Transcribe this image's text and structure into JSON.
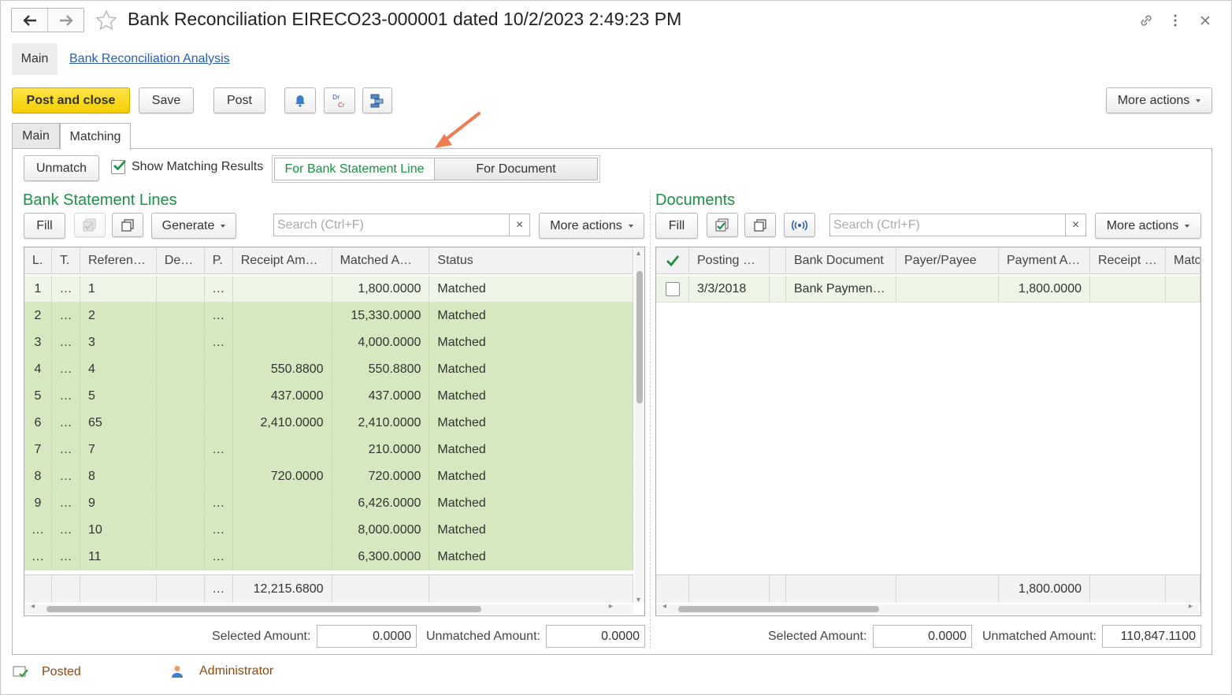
{
  "header": {
    "title": "Bank Reconciliation EIRECO23-000001 dated 10/2/2023 2:49:23 PM"
  },
  "top_links": {
    "main": "Main",
    "analysis": "Bank Reconciliation Analysis"
  },
  "toolbar": {
    "post_and_close": "Post and close",
    "save": "Save",
    "post": "Post",
    "more_actions": "More actions"
  },
  "tabs": [
    "Main",
    "Matching"
  ],
  "matching": {
    "unmatch": "Unmatch",
    "show_results": "Show Matching Results",
    "toggle": {
      "left": "For Bank Statement Line",
      "right": "For Document"
    }
  },
  "bank_lines": {
    "title": "Bank Statement Lines",
    "fill": "Fill",
    "generate": "Generate",
    "search_placeholder": "Search (Ctrl+F)",
    "more_actions": "More actions",
    "columns": [
      "L.",
      "T.",
      "Referen…",
      "De…",
      "P.",
      "Receipt Am…",
      "Matched A…",
      "Status"
    ],
    "rows": [
      [
        "1",
        "…",
        "1",
        "",
        "…",
        "",
        "1,800.0000",
        "Matched"
      ],
      [
        "2",
        "…",
        "2",
        "",
        "…",
        "",
        "15,330.0000",
        "Matched"
      ],
      [
        "3",
        "…",
        "3",
        "",
        "…",
        "",
        "4,000.0000",
        "Matched"
      ],
      [
        "4",
        "…",
        "4",
        "",
        "",
        "550.8800",
        "550.8800",
        "Matched"
      ],
      [
        "5",
        "…",
        "5",
        "",
        "",
        "437.0000",
        "437.0000",
        "Matched"
      ],
      [
        "6",
        "…",
        "65",
        "",
        "",
        "2,410.0000",
        "2,410.0000",
        "Matched"
      ],
      [
        "7",
        "…",
        "7",
        "",
        "…",
        "",
        "210.0000",
        "Matched"
      ],
      [
        "8",
        "…",
        "8",
        "",
        "",
        "720.0000",
        "720.0000",
        "Matched"
      ],
      [
        "9",
        "…",
        "9",
        "",
        "…",
        "",
        "6,426.0000",
        "Matched"
      ],
      [
        "…",
        "…",
        "10",
        "",
        "…",
        "",
        "8,000.0000",
        "Matched"
      ],
      [
        "…",
        "…",
        "11",
        "",
        "…",
        "",
        "6,300.0000",
        "Matched"
      ]
    ],
    "footer": [
      "",
      "",
      "",
      "",
      "…",
      "12,215.6800",
      "",
      ""
    ],
    "selected_label": "Selected Amount:",
    "selected_value": "0.0000",
    "unmatched_label": "Unmatched Amount:",
    "unmatched_value": "0.0000"
  },
  "documents": {
    "title": "Documents",
    "fill": "Fill",
    "search_placeholder": "Search (Ctrl+F)",
    "more_actions": "More actions",
    "columns": [
      "",
      "Posting …",
      "",
      "Bank Document",
      "Payer/Payee",
      "Payment A…",
      "Receipt …",
      "Matc"
    ],
    "rows": [
      [
        "",
        "3/3/2018",
        "",
        "Bank Paymen…",
        "",
        "1,800.0000",
        "",
        ""
      ]
    ],
    "footer": [
      "",
      "",
      "",
      "",
      "",
      "1,800.0000",
      "",
      ""
    ],
    "selected_label": "Selected Amount:",
    "selected_value": "0.0000",
    "unmatched_label": "Unmatched Amount:",
    "unmatched_value": "110,847.1100"
  },
  "status_bar": {
    "state": "Posted",
    "user": "Administrator"
  },
  "colors": {
    "accent_green": "#1a9146",
    "primary_yellow": "#f4cd00",
    "matched_row": "#d6e8bf",
    "arrow": "#f07b50"
  }
}
